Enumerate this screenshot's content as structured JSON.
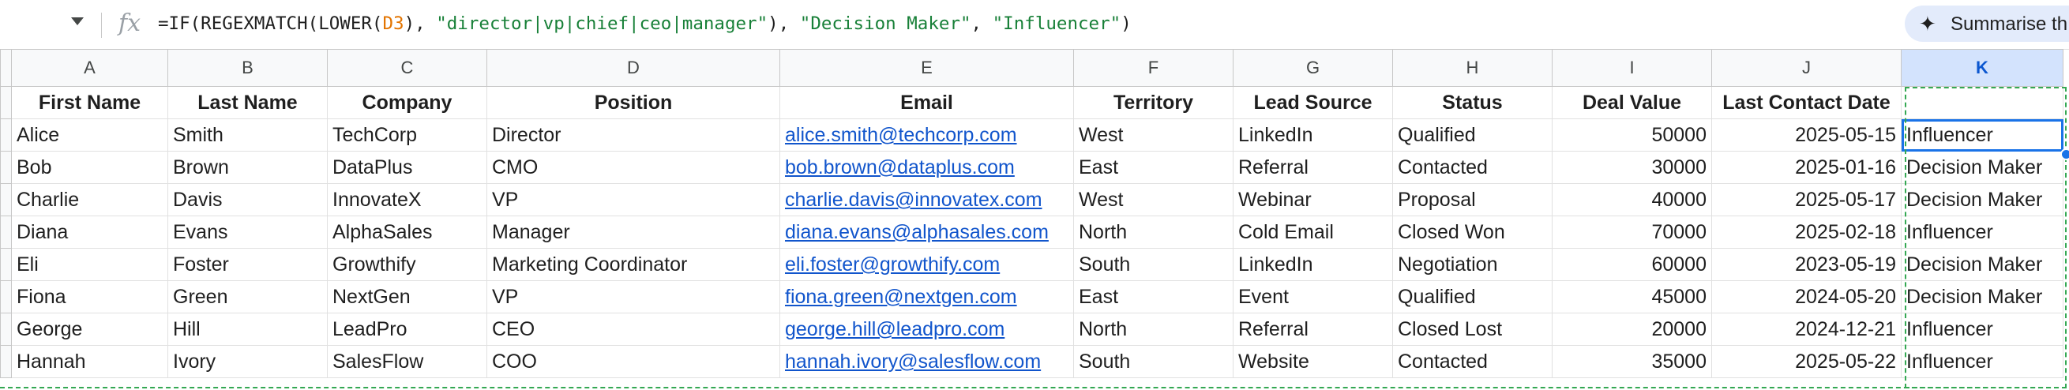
{
  "formula_bar": {
    "parts": [
      {
        "text": "=IF(REGEXMATCH(LOWER(",
        "kind": "plain"
      },
      {
        "text": "D3",
        "kind": "ref"
      },
      {
        "text": "), ",
        "kind": "plain"
      },
      {
        "text": "\"director|vp|chief|ceo|manager\"",
        "kind": "str"
      },
      {
        "text": "), ",
        "kind": "plain"
      },
      {
        "text": "\"Decision Maker\"",
        "kind": "str"
      },
      {
        "text": ", ",
        "kind": "plain"
      },
      {
        "text": "\"Influencer\"",
        "kind": "str"
      },
      {
        "text": ")",
        "kind": "plain"
      }
    ],
    "summarise_label": "Summarise th"
  },
  "colors": {
    "accent": "#1a73e8",
    "link": "#1155cc",
    "formula_ref": "#e37400",
    "formula_string": "#188038",
    "selected_col_header": "#d3e3fd"
  },
  "grid": {
    "column_letters": [
      "A",
      "B",
      "C",
      "D",
      "E",
      "F",
      "G",
      "H",
      "I",
      "J",
      "K"
    ],
    "selected_column": "K",
    "headers": [
      "First Name",
      "Last Name",
      "Company",
      "Position",
      "Email",
      "Territory",
      "Lead Source",
      "Status",
      "Deal Value",
      "Last Contact Date",
      ""
    ],
    "rows": [
      [
        "Alice",
        "Smith",
        "TechCorp",
        "Director",
        "alice.smith@techcorp.com",
        "West",
        "LinkedIn",
        "Qualified",
        "50000",
        "2025-05-15",
        "Influencer"
      ],
      [
        "Bob",
        "Brown",
        "DataPlus",
        "CMO",
        "bob.brown@dataplus.com",
        "East",
        "Referral",
        "Contacted",
        "30000",
        "2025-01-16",
        "Decision Maker"
      ],
      [
        "Charlie",
        "Davis",
        "InnovateX",
        "VP",
        "charlie.davis@innovatex.com",
        "West",
        "Webinar",
        "Proposal",
        "40000",
        "2025-05-17",
        "Decision Maker"
      ],
      [
        "Diana",
        "Evans",
        "AlphaSales",
        "Manager",
        "diana.evans@alphasales.com",
        "North",
        "Cold Email",
        "Closed Won",
        "70000",
        "2025-02-18",
        "Influencer"
      ],
      [
        "Eli",
        "Foster",
        "Growthify",
        "Marketing Coordinator",
        "eli.foster@growthify.com",
        "South",
        "LinkedIn",
        "Negotiation",
        "60000",
        "2023-05-19",
        "Decision Maker"
      ],
      [
        "Fiona",
        "Green",
        "NextGen",
        "VP",
        "fiona.green@nextgen.com",
        "East",
        "Event",
        "Qualified",
        "45000",
        "2024-05-20",
        "Decision Maker"
      ],
      [
        "George",
        "Hill",
        "LeadPro",
        "CEO",
        "george.hill@leadpro.com",
        "North",
        "Referral",
        "Closed Lost",
        "20000",
        "2024-12-21",
        "Influencer"
      ],
      [
        "Hannah",
        "Ivory",
        "SalesFlow",
        "COO",
        "hannah.ivory@salesflow.com",
        "South",
        "Website",
        "Contacted",
        "35000",
        "2025-05-22",
        "Influencer"
      ]
    ]
  }
}
